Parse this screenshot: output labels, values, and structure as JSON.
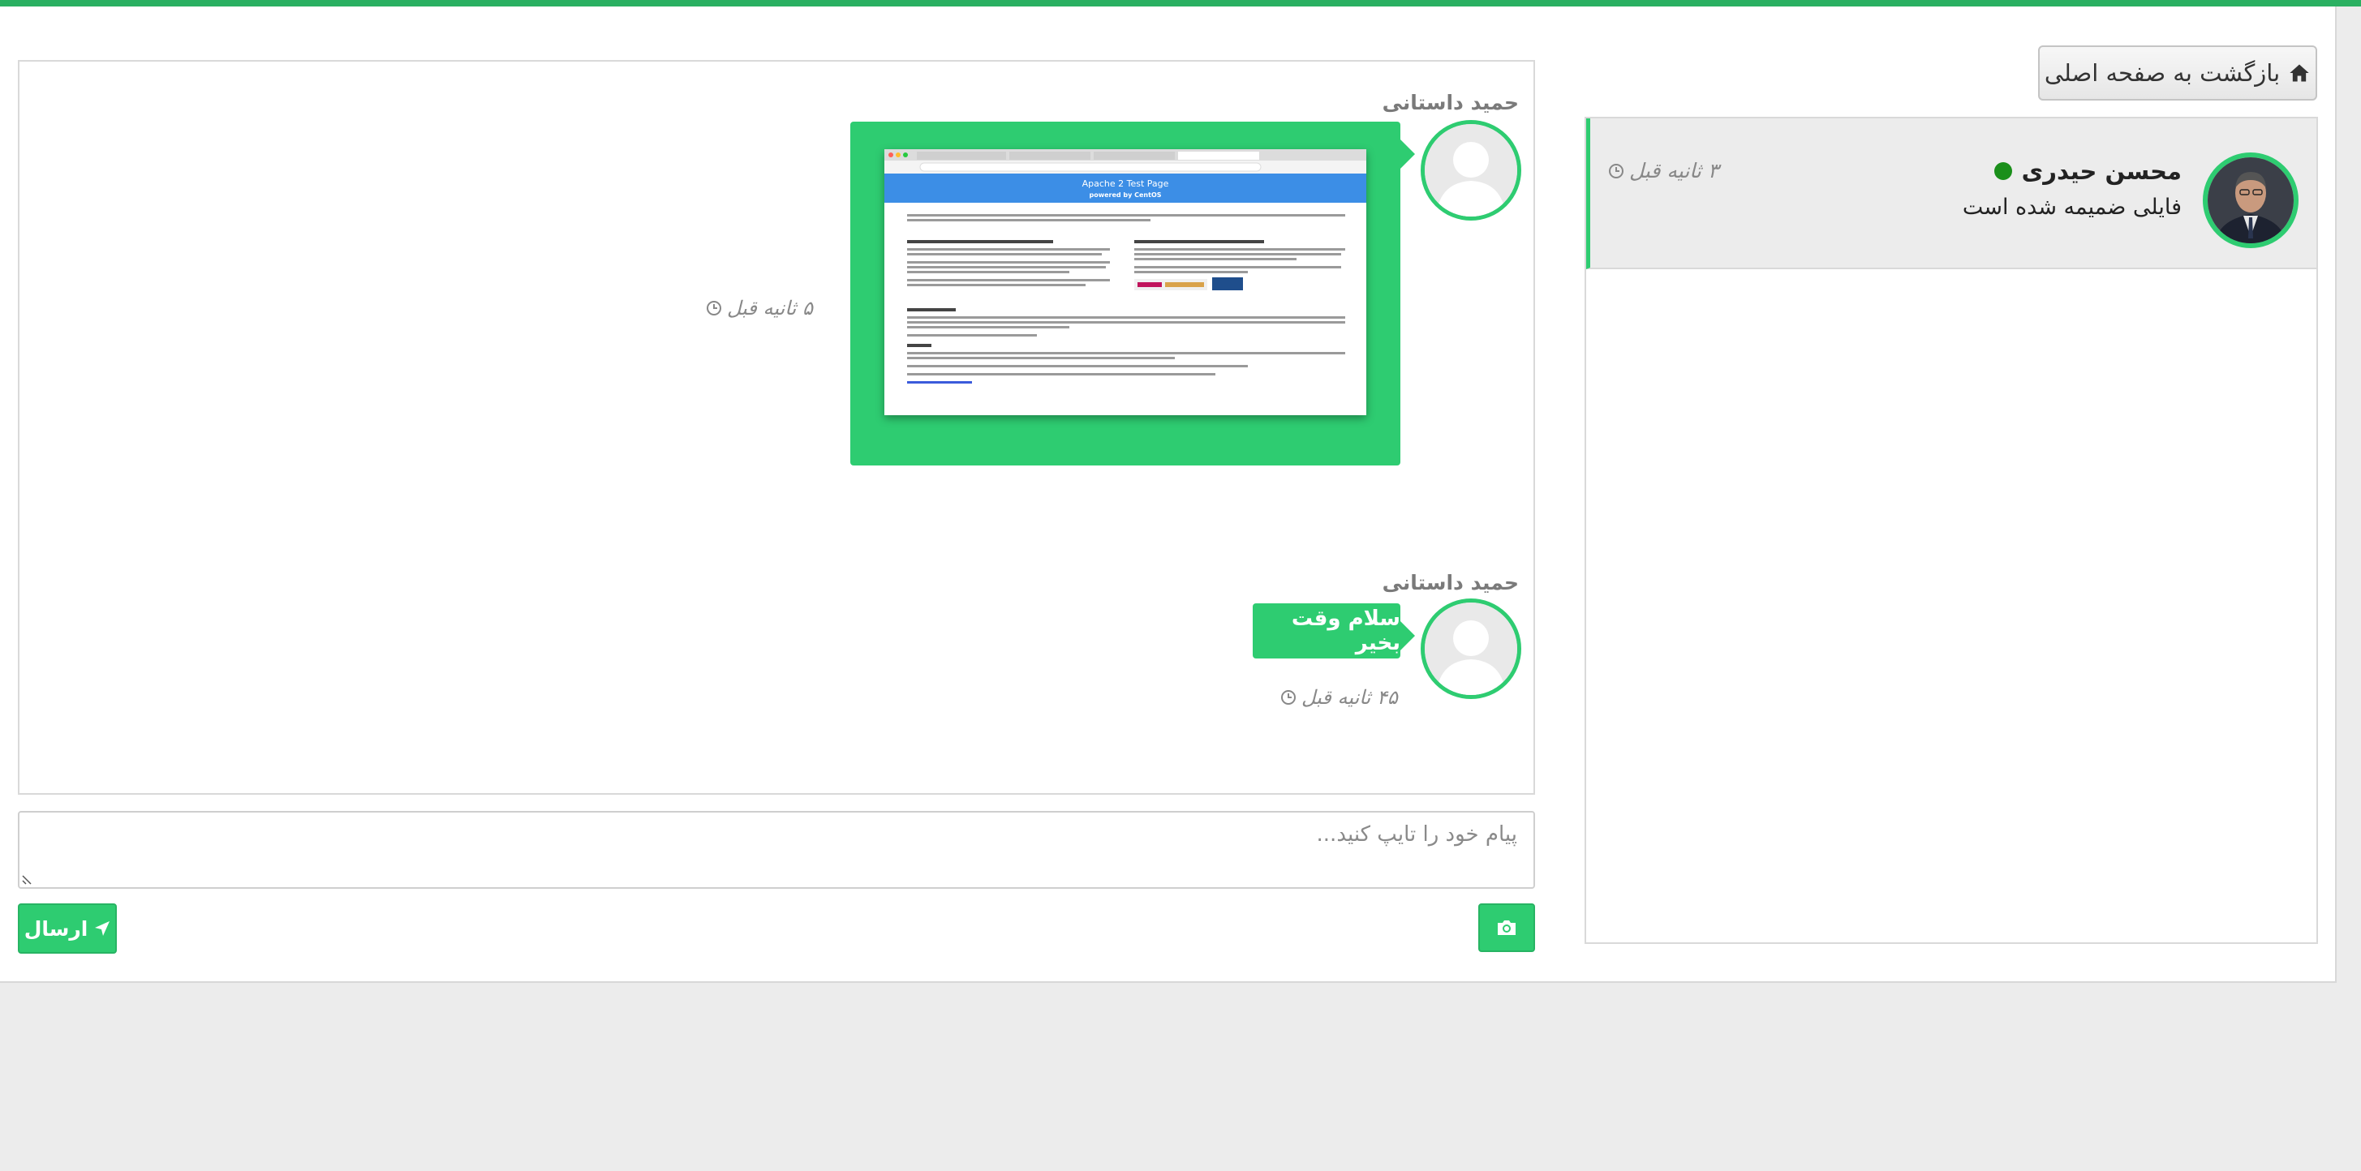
{
  "header": {
    "back_button_label": "بازگشت به صفحه اصلی",
    "back_button_icon": "home-icon"
  },
  "contacts": [
    {
      "name": "محسن حیدری",
      "preview": "فایلی ضمیمه شده است",
      "time": "۳ ثانیه قبل",
      "status": "online",
      "status_color": "#1a8f1a"
    }
  ],
  "messages": [
    {
      "sender": "حمید داستانی",
      "type": "image",
      "time": "۵ ثانیه قبل",
      "attachment": {
        "page_title": "Apache 2 Test Page",
        "page_subtitle": "powered by CentOS"
      }
    },
    {
      "sender": "حمید داستانی",
      "type": "text",
      "text": "سلام وقت بخیر",
      "time": "۴۵ ثانیه قبل"
    }
  ],
  "composer": {
    "placeholder": "پیام خود را تایپ کنید...",
    "send_label": "ارسال",
    "send_icon": "paper-plane-icon",
    "camera_icon": "camera-icon"
  },
  "colors": {
    "accent": "#2ecc71",
    "topbar": "#2ab061",
    "background": "#ececec"
  }
}
